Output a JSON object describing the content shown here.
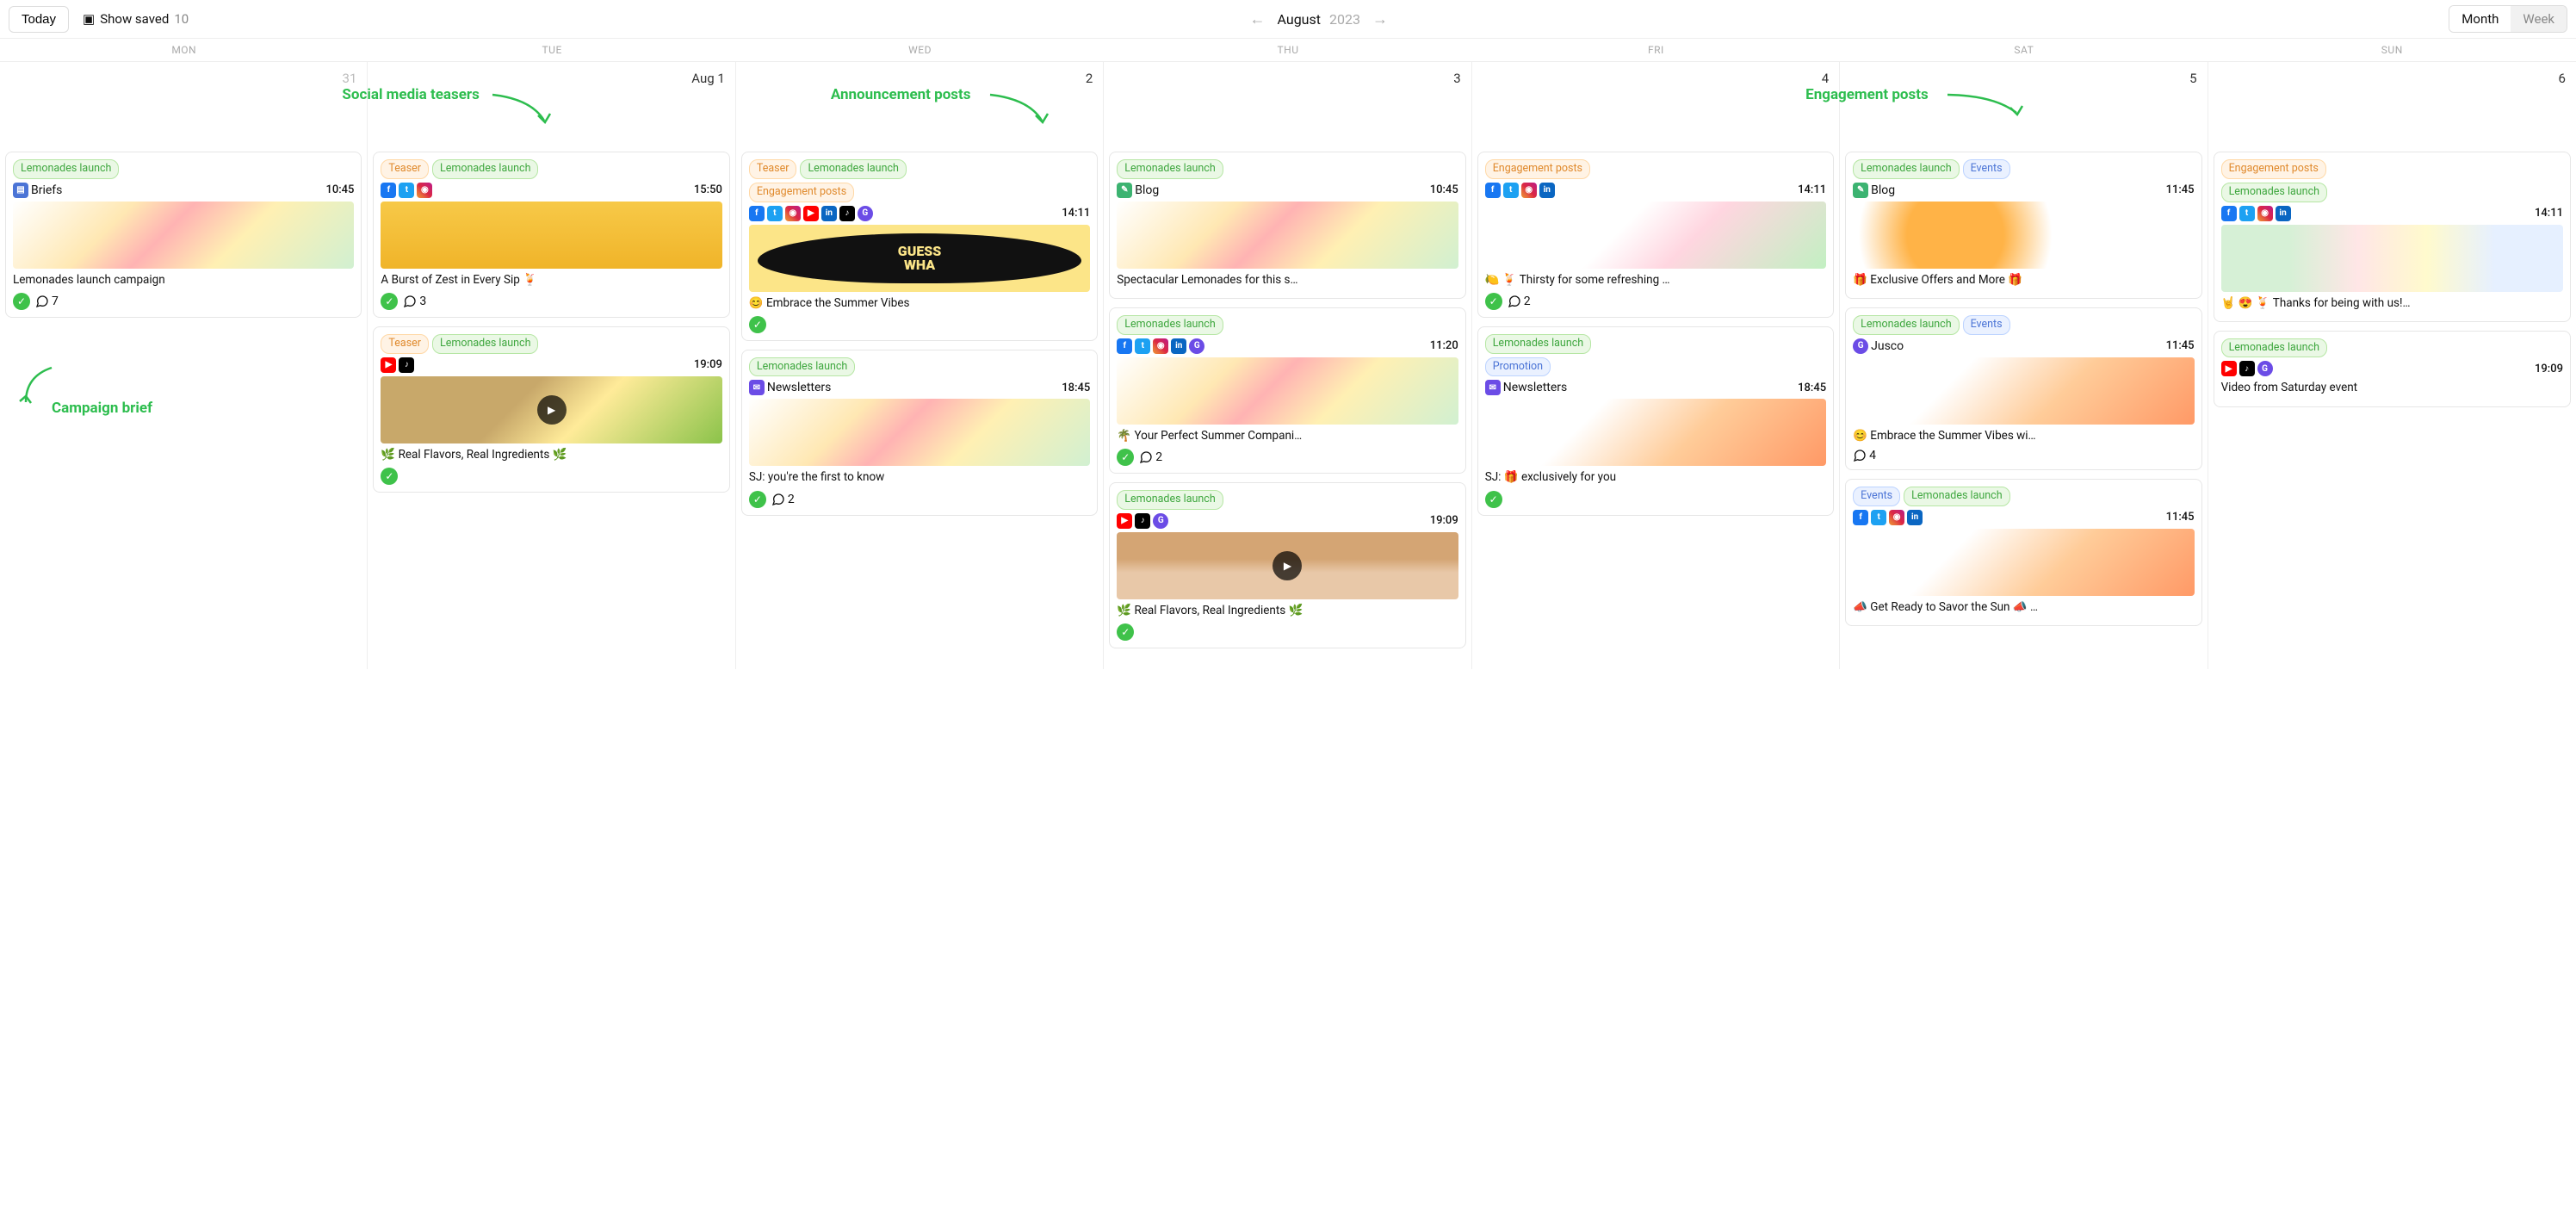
{
  "topbar": {
    "today": "Today",
    "show_saved": "Show saved",
    "saved_count": "10",
    "month": "August",
    "year": "2023",
    "view_month": "Month",
    "view_week": "Week"
  },
  "weekdays": [
    "MON",
    "TUE",
    "WED",
    "THU",
    "FRI",
    "SAT",
    "SUN"
  ],
  "annotations": {
    "brief": "Campaign brief",
    "teasers": "Social media teasers",
    "announce": "Announcement posts",
    "engage": "Engagement posts"
  },
  "days": [
    {
      "num": "31",
      "muted": true
    },
    {
      "num": "Aug 1"
    },
    {
      "num": "2"
    },
    {
      "num": "3"
    },
    {
      "num": "4"
    },
    {
      "num": "5"
    },
    {
      "num": "6"
    }
  ],
  "cards": {
    "c31a": {
      "tags": [
        "Lemonades launch"
      ],
      "channel": "Briefs",
      "time": "10:45",
      "title": "Lemonades launch campaign",
      "comments": "7"
    },
    "c1a": {
      "tags": [
        "Teaser",
        "Lemonades launch"
      ],
      "time": "15:50",
      "title": "A Burst of Zest in Every Sip 🍹",
      "comments": "3"
    },
    "c1b": {
      "tags": [
        "Teaser",
        "Lemonades launch"
      ],
      "time": "19:09",
      "title": "🌿 Real Flavors, Real Ingredients 🌿"
    },
    "c2a": {
      "tags": [
        "Teaser",
        "Lemonades launch",
        "Engagement posts"
      ],
      "time": "14:11",
      "title": "😊 Embrace the Summer Vibes"
    },
    "c2b": {
      "tags": [
        "Lemonades launch"
      ],
      "channel": "Newsletters",
      "time": "18:45",
      "title": "SJ: you're the first to know",
      "comments": "2"
    },
    "c3a": {
      "tags": [
        "Lemonades launch"
      ],
      "channel": "Blog",
      "time": "10:45",
      "title": "Spectacular Lemonades for this s…"
    },
    "c3b": {
      "tags": [
        "Lemonades launch"
      ],
      "time": "11:20",
      "title": "🌴 Your Perfect Summer Compani…",
      "comments": "2"
    },
    "c3c": {
      "tags": [
        "Lemonades launch"
      ],
      "time": "19:09",
      "title": "🌿 Real Flavors, Real Ingredients 🌿"
    },
    "c4a": {
      "tags": [
        "Engagement posts"
      ],
      "time": "14:11",
      "title": "🍋 🍹 Thirsty for some refreshing …",
      "comments": "2"
    },
    "c4b": {
      "tags": [
        "Lemonades launch",
        "Promotion"
      ],
      "channel": "Newsletters",
      "time": "18:45",
      "title": "SJ: 🎁 exclusively for you"
    },
    "c5a": {
      "tags": [
        "Lemonades launch",
        "Events"
      ],
      "channel": "Blog",
      "time": "11:45",
      "title": "🎁 Exclusive Offers and More 🎁"
    },
    "c5b": {
      "tags": [
        "Lemonades launch",
        "Events"
      ],
      "channel": "Jusco",
      "time": "11:45",
      "title": "😊 Embrace the Summer Vibes wi…",
      "comments": "4"
    },
    "c5c": {
      "tags": [
        "Events",
        "Lemonades launch"
      ],
      "time": "11:45",
      "title": "📣 Get Ready to Savor the Sun 📣 …"
    },
    "c6a": {
      "tags": [
        "Engagement posts",
        "Lemonades launch"
      ],
      "time": "14:11",
      "title": "🤘 😍 🍹 Thanks for being with us!…"
    },
    "c6b": {
      "tags": [
        "Lemonades launch"
      ],
      "time": "19:09",
      "title": "Video from Saturday event"
    }
  },
  "tag_labels": {
    "Lemonades launch": "Lemonades launch",
    "Teaser": "Teaser",
    "Engagement posts": "Engagement posts",
    "Events": "Events",
    "Promotion": "Promotion"
  }
}
